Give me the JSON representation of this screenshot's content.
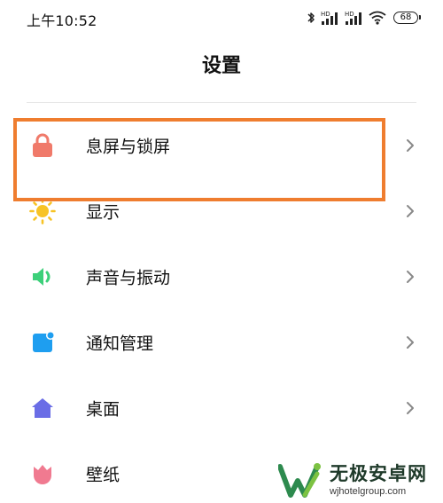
{
  "status_bar": {
    "time": "上午10:52",
    "signal_label_1": "HD",
    "signal_label_2": "HD",
    "battery": "68"
  },
  "header": {
    "title": "设置"
  },
  "settings": {
    "items": [
      {
        "label": "息屏与锁屏",
        "icon": "lock-icon",
        "color": "#f07a6a"
      },
      {
        "label": "显示",
        "icon": "sun-icon",
        "color": "#f7c325"
      },
      {
        "label": "声音与振动",
        "icon": "speaker-icon",
        "color": "#3dd07a"
      },
      {
        "label": "通知管理",
        "icon": "notification-icon",
        "color": "#1e9ef0"
      },
      {
        "label": "桌面",
        "icon": "home-icon",
        "color": "#6a6de6"
      },
      {
        "label": "壁纸",
        "icon": "tulip-icon",
        "color": "#f07a90"
      }
    ]
  },
  "highlight": {
    "color": "#ef7d2f"
  },
  "watermark": {
    "title": "无极安卓网",
    "url": "wjhotelgroup.com"
  }
}
